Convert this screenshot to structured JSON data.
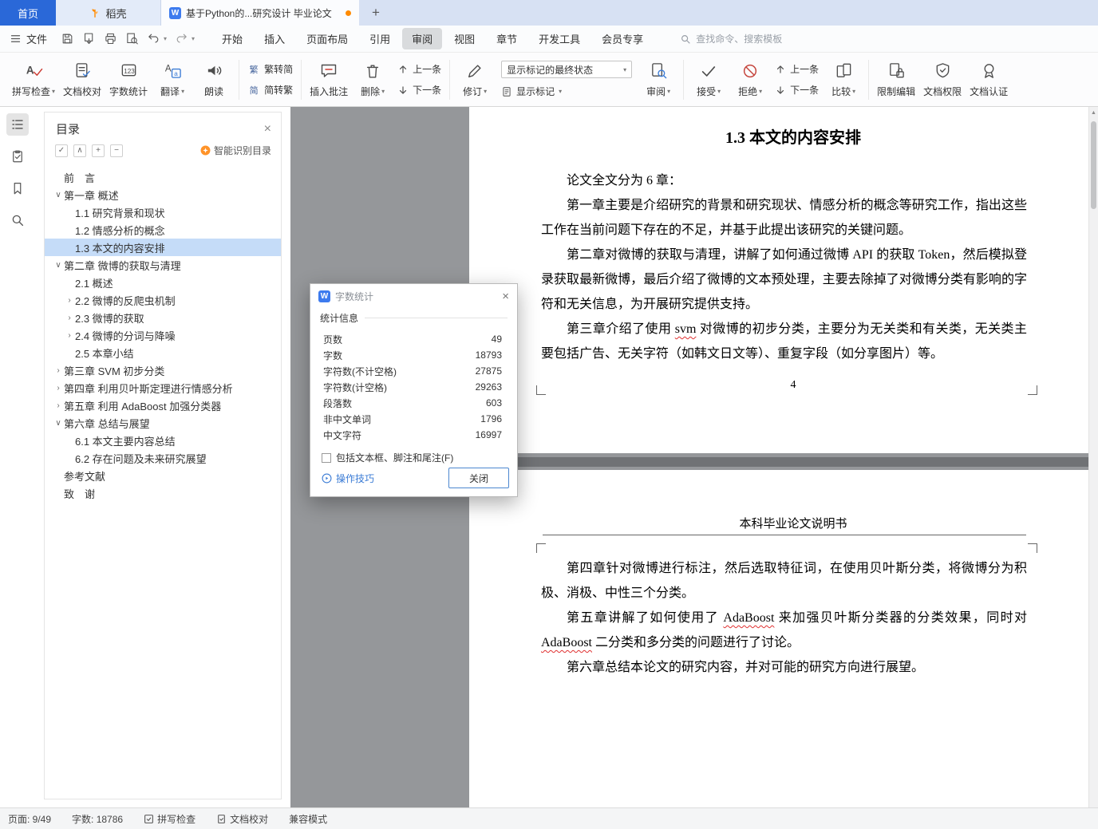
{
  "titlebar": {
    "home_tab": "首页",
    "docer_tab": "稻壳",
    "document_tab": "基于Python的...研究设计 毕业论文",
    "new_tab": "+"
  },
  "menubar": {
    "file": "文件",
    "tabs": [
      "开始",
      "插入",
      "页面布局",
      "引用",
      "审阅",
      "视图",
      "章节",
      "开发工具",
      "会员专享"
    ],
    "active_tab": "审阅",
    "search_placeholder": "查找命令、搜索模板"
  },
  "ribbon": {
    "spell_check": "拼写检查",
    "doc_proof": "文档校对",
    "word_count": "字数统计",
    "translate": "翻译",
    "read_aloud": "朗读",
    "trad_to_simp": "繁转简",
    "simp_to_trad": "简转繁",
    "insert_comment": "插入批注",
    "delete": "删除",
    "prev_comment": "上一条",
    "next_comment": "下一条",
    "track_changes": "修订",
    "markup_state": "显示标记的最终状态",
    "show_markup": "显示标记",
    "review": "审阅",
    "accept": "接受",
    "reject": "拒绝",
    "prev_change": "上一条",
    "next_change": "下一条",
    "compare": "比较",
    "restrict_edit": "限制编辑",
    "doc_permission": "文档权限",
    "doc_certify": "文档认证"
  },
  "toc": {
    "title": "目录",
    "smart_label": "智能识别目录",
    "items": [
      {
        "label": "前　言",
        "level": 1,
        "arrow": "none"
      },
      {
        "label": "第一章 概述",
        "level": 1,
        "arrow": "down"
      },
      {
        "label": "1.1 研究背景和现状",
        "level": 2,
        "arrow": "none"
      },
      {
        "label": "1.2 情感分析的概念",
        "level": 2,
        "arrow": "none"
      },
      {
        "label": "1.3 本文的内容安排",
        "level": 2,
        "arrow": "none",
        "selected": true
      },
      {
        "label": "第二章 微博的获取与清理",
        "level": 1,
        "arrow": "down"
      },
      {
        "label": "2.1 概述",
        "level": 2,
        "arrow": "none"
      },
      {
        "label": "2.2 微博的反爬虫机制",
        "level": 2,
        "arrow": "right"
      },
      {
        "label": "2.3 微博的获取",
        "level": 2,
        "arrow": "right"
      },
      {
        "label": "2.4 微博的分词与降噪",
        "level": 2,
        "arrow": "right"
      },
      {
        "label": "2.5 本章小结",
        "level": 2,
        "arrow": "none"
      },
      {
        "label": "第三章 SVM 初步分类",
        "level": 1,
        "arrow": "right"
      },
      {
        "label": "第四章 利用贝叶斯定理进行情感分析",
        "level": 1,
        "arrow": "right"
      },
      {
        "label": "第五章 利用 AdaBoost 加强分类器",
        "level": 1,
        "arrow": "right"
      },
      {
        "label": "第六章 总结与展望",
        "level": 1,
        "arrow": "down"
      },
      {
        "label": "6.1 本文主要内容总结",
        "level": 2,
        "arrow": "none"
      },
      {
        "label": "6.2 存在问题及未来研究展望",
        "level": 2,
        "arrow": "none"
      },
      {
        "label": "参考文献",
        "level": 1,
        "arrow": "none"
      },
      {
        "label": "致　谢",
        "level": 1,
        "arrow": "none"
      }
    ]
  },
  "word_count_dialog": {
    "title": "字数统计",
    "section_label": "统计信息",
    "rows": [
      {
        "label": "页数",
        "value": "49"
      },
      {
        "label": "字数",
        "value": "18793"
      },
      {
        "label": "字符数(不计空格)",
        "value": "27875"
      },
      {
        "label": "字符数(计空格)",
        "value": "29263"
      },
      {
        "label": "段落数",
        "value": "603"
      },
      {
        "label": "非中文单词",
        "value": "1796"
      },
      {
        "label": "中文字符",
        "value": "16997"
      }
    ],
    "include_checkbox": "包括文本框、脚注和尾注(F)",
    "tips_link": "操作技巧",
    "close_button": "关闭"
  },
  "document": {
    "page1": {
      "heading": "1.3  本文的内容安排",
      "paragraphs": [
        [
          {
            "t": "论文全文分为 6 章："
          }
        ],
        [
          {
            "t": "第一章主要是介绍研究的背景和研究现状、情感分析的概念等研究工作，指出这些工作在当前问题下存在的不足，并基于此提出该研究的关键问题。"
          }
        ],
        [
          {
            "t": "第二章对微博的获取与清理，讲解了如何通过微博 API 的获取 Token，然后模拟登录获取最新微博，最后介绍了微博的文本预处理，主要去除掉了对微博分类有影响的字符和无关信息，为开展研究提供支持。"
          }
        ],
        [
          {
            "t": "第三章介绍了使用 "
          },
          {
            "t": "svm",
            "w": true
          },
          {
            "t": " 对微博的初步分类，主要分为无关类和有关类，无关类主要包括广告、无关字符（如韩文日文等）、重复字段（如分享图片）等。"
          }
        ]
      ],
      "page_number": "4"
    },
    "page2": {
      "header": "本科毕业论文说明书",
      "paragraphs": [
        [
          {
            "t": "第四章针对微博进行标注，然后选取特征词，在使用贝叶斯分类，将微博分为积极、消极、中性三个分类。"
          }
        ],
        [
          {
            "t": "第五章讲解了如何使用了 "
          },
          {
            "t": "AdaBoost",
            "w": true
          },
          {
            "t": " 来加强贝叶斯分类器的分类效果，同时对 "
          },
          {
            "t": "AdaBoost",
            "w": true
          },
          {
            "t": " 二分类和多分类的问题进行了讨论。"
          }
        ],
        [
          {
            "t": "第六章总结本论文的研究内容，并对可能的研究方向进行展望。"
          }
        ]
      ]
    }
  },
  "statusbar": {
    "page": "页面: 9/49",
    "words": "字数: 18786",
    "spell": "拼写检查",
    "proof": "文档校对",
    "mode": "兼容模式"
  }
}
